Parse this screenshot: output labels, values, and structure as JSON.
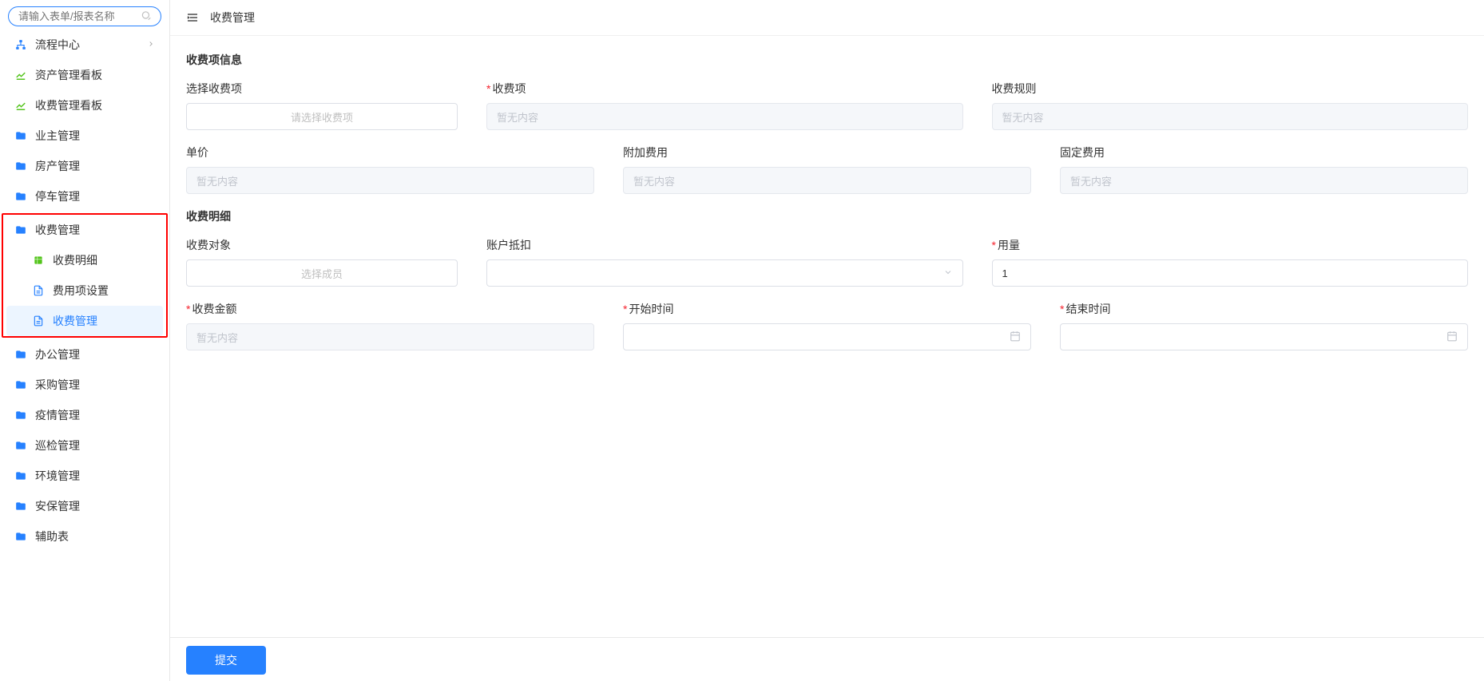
{
  "sidebar": {
    "search_placeholder": "请输入表单/报表名称",
    "items": [
      {
        "key": "flow-center",
        "label": "流程中心",
        "icon": "sitemap",
        "color": "ic-blue",
        "has_arrow": true
      },
      {
        "key": "asset-dashboard",
        "label": "资产管理看板",
        "icon": "chart",
        "color": "ic-green"
      },
      {
        "key": "fee-dashboard",
        "label": "收费管理看板",
        "icon": "chart",
        "color": "ic-green"
      },
      {
        "key": "owner-mgmt",
        "label": "业主管理",
        "icon": "folder",
        "color": "ic-blue"
      },
      {
        "key": "property-mgmt",
        "label": "房产管理",
        "icon": "folder",
        "color": "ic-blue"
      },
      {
        "key": "parking-mgmt",
        "label": "停车管理",
        "icon": "folder",
        "color": "ic-blue"
      }
    ],
    "highlight_group": {
      "parent": {
        "key": "fee-mgmt",
        "label": "收费管理",
        "icon": "folder",
        "color": "ic-blue"
      },
      "children": [
        {
          "key": "fee-detail",
          "label": "收费明细",
          "icon": "sheet",
          "color": "ic-green"
        },
        {
          "key": "fee-item-config",
          "label": "费用项设置",
          "icon": "doc",
          "color": "ic-blue"
        },
        {
          "key": "fee-admin",
          "label": "收费管理",
          "icon": "doc",
          "color": "ic-blue",
          "active": true
        }
      ]
    },
    "items_after": [
      {
        "key": "office-mgmt",
        "label": "办公管理",
        "icon": "folder",
        "color": "ic-blue"
      },
      {
        "key": "purchase-mgmt",
        "label": "采购管理",
        "icon": "folder",
        "color": "ic-blue"
      },
      {
        "key": "epidemic-mgmt",
        "label": "疫情管理",
        "icon": "folder",
        "color": "ic-blue"
      },
      {
        "key": "inspection-mgmt",
        "label": "巡检管理",
        "icon": "folder",
        "color": "ic-blue"
      },
      {
        "key": "env-mgmt",
        "label": "环境管理",
        "icon": "folder",
        "color": "ic-blue"
      },
      {
        "key": "security-mgmt",
        "label": "安保管理",
        "icon": "folder",
        "color": "ic-blue"
      },
      {
        "key": "aux-table",
        "label": "辅助表",
        "icon": "folder",
        "color": "ic-blue"
      }
    ]
  },
  "header": {
    "title": "收费管理"
  },
  "sections": {
    "fee_info_title": "收费项信息",
    "fee_detail_title": "收费明细"
  },
  "form": {
    "select_fee_item": {
      "label": "选择收费项",
      "placeholder": "请选择收费项"
    },
    "fee_item": {
      "label": "收费项",
      "placeholder": "暂无内容"
    },
    "fee_rule": {
      "label": "收费规则",
      "placeholder": "暂无内容"
    },
    "unit_price": {
      "label": "单价",
      "placeholder": "暂无内容"
    },
    "extra_fee": {
      "label": "附加费用",
      "placeholder": "暂无内容"
    },
    "fixed_fee": {
      "label": "固定费用",
      "placeholder": "暂无内容"
    },
    "fee_target": {
      "label": "收费对象",
      "placeholder": "选择成员"
    },
    "account_deduct": {
      "label": "账户抵扣",
      "placeholder": ""
    },
    "usage": {
      "label": "用量",
      "value": "1"
    },
    "fee_amount": {
      "label": "收费金额",
      "placeholder": "暂无内容"
    },
    "start_time": {
      "label": "开始时间"
    },
    "end_time": {
      "label": "结束时间"
    }
  },
  "footer": {
    "submit_label": "提交"
  }
}
